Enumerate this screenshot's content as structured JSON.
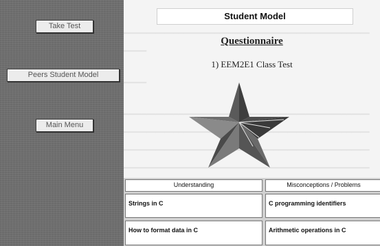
{
  "sidebar": {
    "take_test": "Take Test",
    "peers_student_model": "Peers Student Model",
    "main_menu": "Main Menu"
  },
  "main": {
    "title": "Student Model",
    "questionnaire": "Questionnaire",
    "test_name": "1) EEM2E1 Class Test"
  },
  "table": {
    "headers": [
      "Understanding",
      "Misconceptions / Problems"
    ],
    "rows": [
      [
        "Strings in C",
        "C programming identifiers"
      ],
      [
        "How to format data in C",
        "Arithmetic operations in C"
      ]
    ]
  },
  "colors": {
    "star_dark": "#4a4a4a",
    "star_mid": "#6a6a6a",
    "star_light": "#8f8f8f",
    "sidebar": "#6e6e6e"
  }
}
